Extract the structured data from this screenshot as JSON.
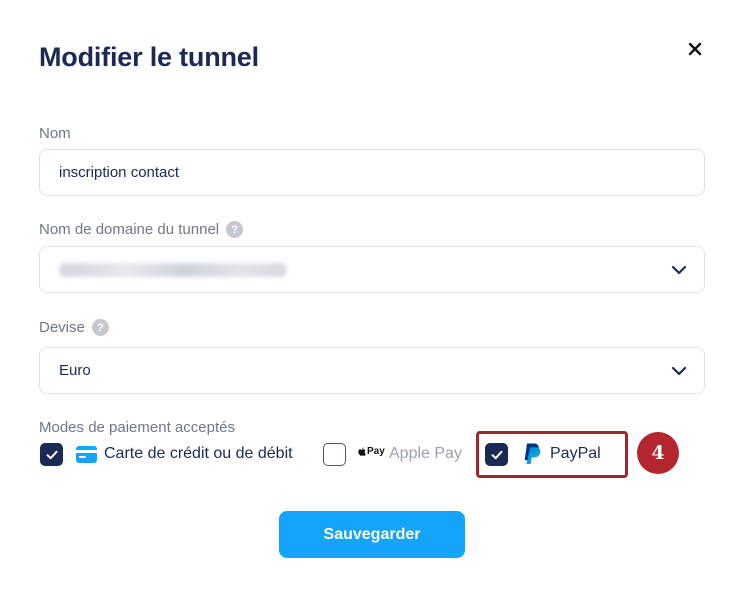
{
  "modal": {
    "title": "Modifier le tunnel",
    "close_icon": "close-icon"
  },
  "form": {
    "name": {
      "label": "Nom",
      "value": "inscription contact"
    },
    "domain": {
      "label": "Nom de domaine du tunnel",
      "help_icon": "question-icon",
      "value_redacted": true,
      "chevron_icon": "chevron-down-icon"
    },
    "currency": {
      "label": "Devise",
      "help_icon": "question-icon",
      "value": "Euro",
      "chevron_icon": "chevron-down-icon"
    },
    "payment": {
      "label": "Modes de paiement acceptés",
      "options": [
        {
          "label": "Carte de crédit ou de débit",
          "checked": true,
          "icon": "credit-card-icon"
        },
        {
          "label": "Apple Pay",
          "logo_text": "Pay",
          "checked": false,
          "icon": "apple-icon"
        },
        {
          "label": "PayPal",
          "checked": true,
          "icon": "paypal-icon"
        }
      ]
    }
  },
  "annotation": {
    "step": "4"
  },
  "actions": {
    "save_label": "Sauvegarder"
  },
  "colors": {
    "title": "#1b2a55",
    "primary_button": "#14a4f9",
    "checkbox_checked": "#1b2a55",
    "highlight": "#a0262e",
    "badge": "#b3262d",
    "card_icon": "#14a4f9",
    "paypal_dark": "#003087",
    "paypal_light": "#009cde"
  }
}
